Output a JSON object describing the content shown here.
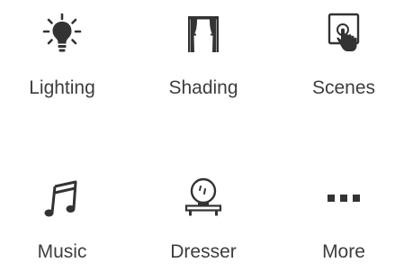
{
  "tiles": [
    {
      "label": "Lighting",
      "icon": "lightbulb-icon"
    },
    {
      "label": "Shading",
      "icon": "curtains-icon"
    },
    {
      "label": "Scenes",
      "icon": "touch-screen-icon"
    },
    {
      "label": "Music",
      "icon": "music-note-icon"
    },
    {
      "label": "Dresser",
      "icon": "dresser-mirror-icon"
    },
    {
      "label": "More",
      "icon": "more-dots-icon"
    }
  ],
  "colors": {
    "icon": "#333333",
    "label": "#3d3d3d",
    "background": "#ffffff"
  }
}
